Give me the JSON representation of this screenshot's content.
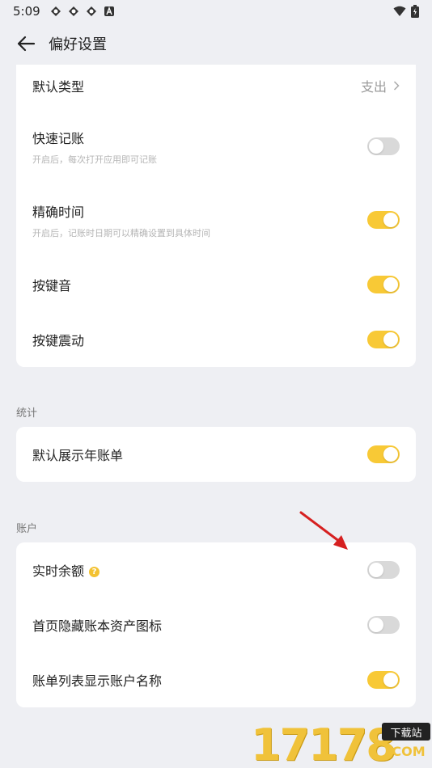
{
  "status_bar": {
    "time": "5:09",
    "left_icons": [
      "settings-like-icon",
      "settings-like-icon",
      "settings-like-icon",
      "a-box-icon"
    ],
    "right_icons": [
      "wifi-icon",
      "battery-icon"
    ]
  },
  "header": {
    "title": "偏好设置",
    "back_icon": "arrow-left-icon"
  },
  "colors": {
    "accent": "#f8c936",
    "toggle_off": "#d9d9d9",
    "background": "#eeeff3",
    "annotation_arrow": "#d62020"
  },
  "card1": {
    "rows": [
      {
        "label": "默认类型",
        "value": "支出",
        "type": "link"
      },
      {
        "label": "快速记账",
        "sub": "开启后，每次打开应用即可记账",
        "type": "toggle",
        "on": false
      },
      {
        "label": "精确时间",
        "sub": "开启后，记账时日期可以精确设置到具体时间",
        "type": "toggle",
        "on": true
      },
      {
        "label": "按键音",
        "type": "toggle",
        "on": true
      },
      {
        "label": "按键震动",
        "type": "toggle",
        "on": true
      }
    ]
  },
  "section_stats": {
    "title": "统计",
    "rows": [
      {
        "label": "默认展示年账单",
        "type": "toggle",
        "on": true
      }
    ]
  },
  "section_account": {
    "title": "账户",
    "rows": [
      {
        "label": "实时余额",
        "help_icon": "question-circle-icon",
        "type": "toggle",
        "on": false
      },
      {
        "label": "首页隐藏账本资产图标",
        "type": "toggle",
        "on": false
      },
      {
        "label": "账单列表显示账户名称",
        "type": "toggle",
        "on": true
      }
    ]
  },
  "watermark": {
    "digits": "17178",
    "badge": "下载站",
    "com": ".COM"
  }
}
